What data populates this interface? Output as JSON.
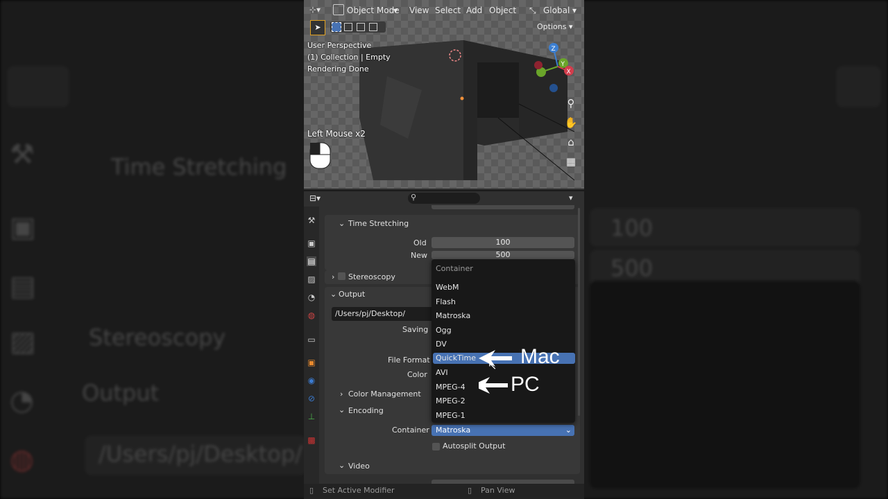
{
  "background": {
    "time_stretching": "Time Stretching",
    "stereoscopy": "Stereoscopy",
    "output": "Output",
    "path": "/Users/pj/Desktop/",
    "old_value": "100",
    "new_value": "500"
  },
  "viewport": {
    "mode": "Object Mode",
    "menus": [
      "View",
      "Select",
      "Add",
      "Object"
    ],
    "transform": "Global",
    "options": "Options",
    "overlay": [
      "User Perspective",
      "(1) Collection | Empty",
      "Rendering Done"
    ],
    "last_op": "Left Mouse x2",
    "axes": {
      "z": "Z",
      "y": "Y",
      "x": "X"
    }
  },
  "properties": {
    "time_stretching": "Time Stretching",
    "old_label": "Old",
    "old_value": "100",
    "new_label": "New",
    "new_value": "500",
    "stereoscopy": "Stereoscopy",
    "output": "Output",
    "path": "/Users/pj/Desktop/",
    "saving": "Saving",
    "file_format": "File Format",
    "color": "Color",
    "color_management": "Color Management",
    "encoding": "Encoding",
    "container_label": "Container",
    "container_value": "Matroska",
    "autosplit": "Autosplit Output",
    "video": "Video"
  },
  "dropdown": {
    "title": "Container",
    "options": [
      "WebM",
      "Flash",
      "Matroska",
      "Ogg",
      "DV",
      "QuickTime",
      "AVI",
      "MPEG-4",
      "MPEG-2",
      "MPEG-1"
    ],
    "selected": "QuickTime"
  },
  "annotations": {
    "mac": "Mac",
    "pc": "PC"
  },
  "statusbar": {
    "left": "Set Active Modifier",
    "right": "Pan View"
  },
  "colors": {
    "accent": "#4772b3",
    "panel": "#303030",
    "popup": "#181818"
  }
}
